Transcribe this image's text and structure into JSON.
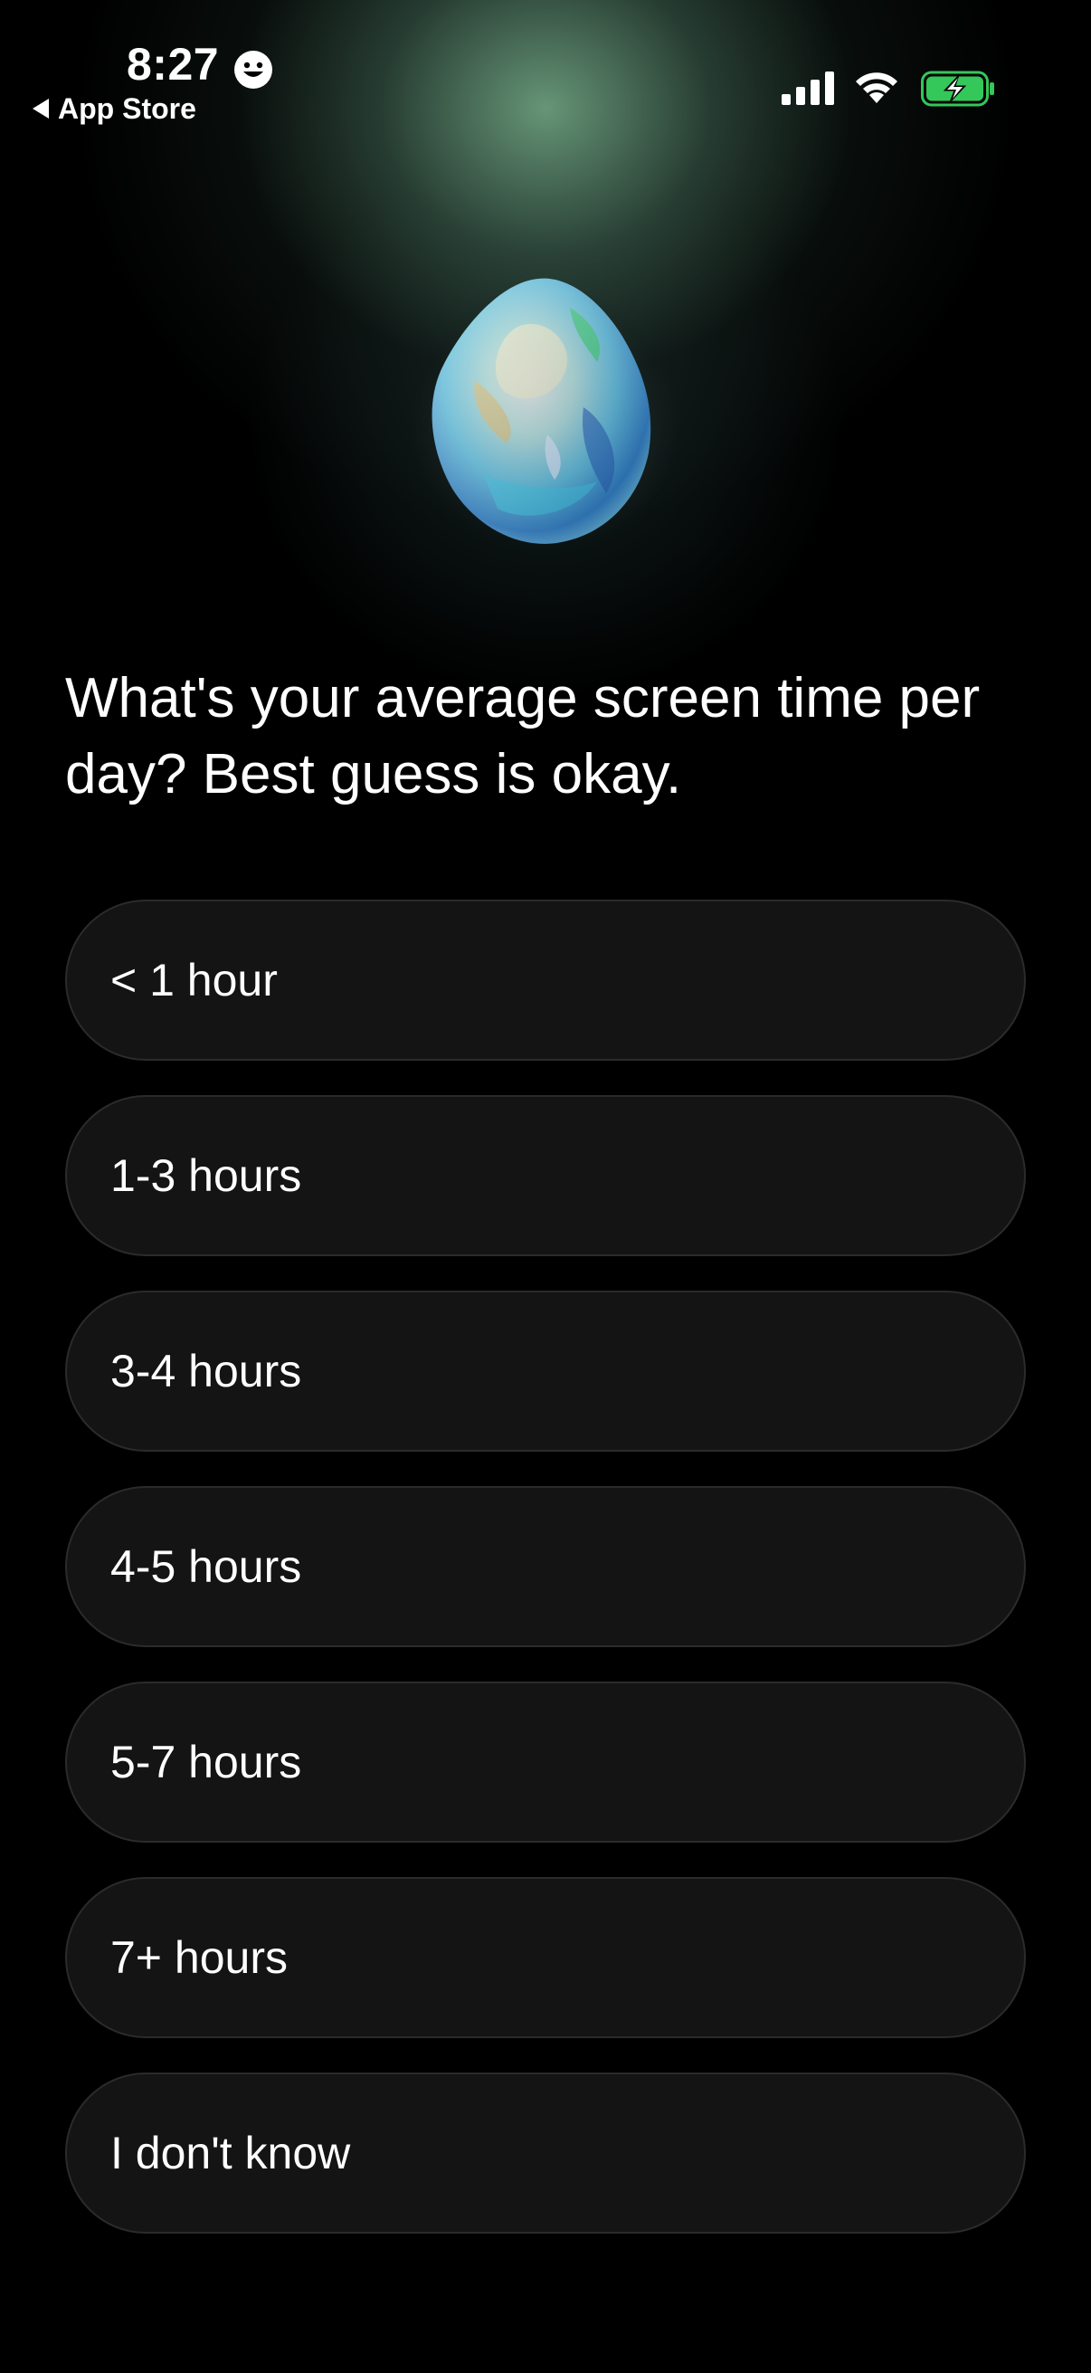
{
  "status_bar": {
    "time": "8:27",
    "back_label": "App Store"
  },
  "colors": {
    "background": "#000000",
    "option_fill": "#141414",
    "option_border": "#2b2b2b",
    "battery_green": "#34c759",
    "glow": "#6fa888"
  },
  "hero": {
    "icon": "opal-gem-icon"
  },
  "question": "What's your average screen time per day? Best guess is okay.",
  "options": [
    {
      "label": "< 1 hour"
    },
    {
      "label": "1-3 hours"
    },
    {
      "label": "3-4 hours"
    },
    {
      "label": "4-5 hours"
    },
    {
      "label": "5-7 hours"
    },
    {
      "label": "7+ hours"
    },
    {
      "label": "I don't know"
    }
  ]
}
